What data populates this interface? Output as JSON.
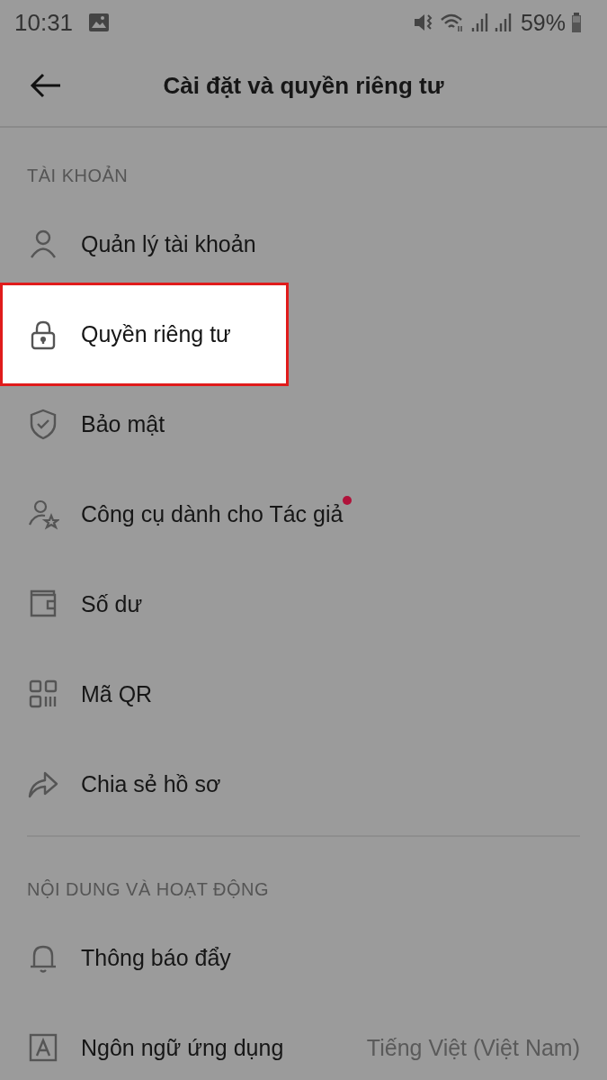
{
  "status_bar": {
    "time": "10:31",
    "battery": "59%"
  },
  "header": {
    "title": "Cài đặt và quyền riêng tư"
  },
  "sections": [
    {
      "title": "TÀI KHOẢN",
      "items": [
        {
          "label": "Quản lý tài khoản",
          "highlighted": false,
          "badge_dot": false
        },
        {
          "label": "Quyền riêng tư",
          "highlighted": true,
          "badge_dot": false
        },
        {
          "label": "Bảo mật",
          "highlighted": false,
          "badge_dot": false
        },
        {
          "label": "Công cụ dành cho Tác giả",
          "highlighted": false,
          "badge_dot": true
        },
        {
          "label": "Số dư",
          "highlighted": false,
          "badge_dot": false
        },
        {
          "label": "Mã QR",
          "highlighted": false,
          "badge_dot": false
        },
        {
          "label": "Chia sẻ hồ sơ",
          "highlighted": false,
          "badge_dot": false
        }
      ]
    },
    {
      "title": "NỘI DUNG VÀ HOẠT ĐỘNG",
      "items": [
        {
          "label": "Thông báo đẩy",
          "highlighted": false,
          "badge_dot": false
        },
        {
          "label": "Ngôn ngữ ứng dụng",
          "highlighted": false,
          "badge_dot": false,
          "value": "Tiếng Việt (Việt Nam)"
        }
      ]
    }
  ]
}
